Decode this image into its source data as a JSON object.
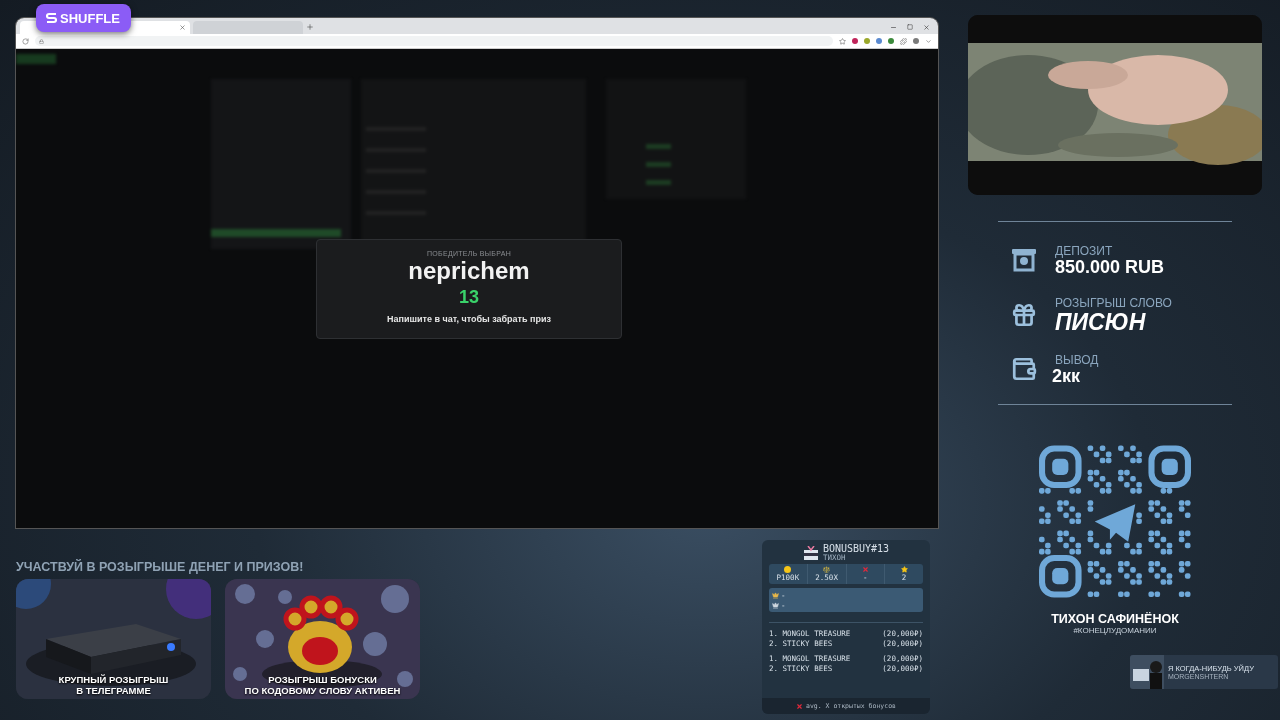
{
  "overlay_badge": {
    "label": "SHUFFLE"
  },
  "browser": {
    "tabs": [
      {
        "selected": true
      },
      {
        "selected": false
      }
    ]
  },
  "winner_modal": {
    "caption": "ПОБЕДИТЕЛЬ ВЫБРАН",
    "winner": "neprichem",
    "number": "13",
    "hint": "Напишите в чат, чтобы забрать приз"
  },
  "giveaway": {
    "heading": "УЧАСТВУЙ В РОЗЫГРЫШЕ ДЕНЕГ И ПРИЗОВ!",
    "cards": [
      {
        "kind": "console",
        "caption": [
          "КРУПНЫЙ РОЗЫГРЫШ",
          "В ТЕЛЕГРАММЕ"
        ]
      },
      {
        "kind": "paw",
        "caption": [
          "РОЗЫГРЫШ БОНУСКИ",
          "ПО КОДОВОМУ СЛОВУ АКТИВЕН"
        ]
      }
    ]
  },
  "bonusbuy": {
    "title": "BONUSBUY#13",
    "subtitle": "ТИХОН",
    "stats": [
      {
        "kind": "cost",
        "value": "Р100К"
      },
      {
        "kind": "multiplier",
        "value": "2.50X"
      },
      {
        "kind": "fail",
        "value": "-"
      },
      {
        "kind": "rating",
        "value": "2"
      }
    ],
    "leaders": [
      "-",
      "-"
    ],
    "groups": [
      [
        {
          "name": "1. MONGOL TREASURE",
          "price": "(20,000₽)"
        },
        {
          "name": "2. STICKY BEES",
          "price": "(20,000₽)"
        }
      ],
      [
        {
          "name": "1. MONGOL TREASURE",
          "price": "(20,000₽)"
        },
        {
          "name": "2. STICKY BEES",
          "price": "(20,000₽)"
        }
      ]
    ],
    "footer": "avg. X открытых бонусов"
  },
  "stats": [
    {
      "kind": "deposit",
      "label": "ДЕПОЗИТ",
      "value": "850.000 RUB"
    },
    {
      "kind": "giveaway",
      "label": "РОЗЫГРЫШ СЛОВО",
      "value": "ПИСЮН"
    },
    {
      "kind": "withdrawal",
      "label": "ВЫВОД",
      "value": "2кк"
    }
  ],
  "streamer": {
    "name": "ТИХОН САФИНЁНОК",
    "hashtag": "#КОНЕЦЛУДОМАНИИ"
  },
  "now_playing": {
    "title": "Я КОГДА-НИБУДЬ УЙДУ",
    "artist": "MORGENSHTERN"
  }
}
